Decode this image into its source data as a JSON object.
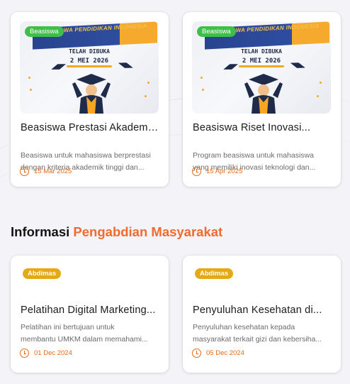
{
  "scholarship_cards": [
    {
      "badge": "Beasiswa",
      "image_banner": "BEASISWA PENDIDIKAN INDONESIA",
      "image_headline": "TELAH DIBUKA",
      "image_date": "2 MEI 2026",
      "title": "Beasiswa Prestasi Akademi...",
      "desc_line1": "Beasiswa untuk mahasiswa berprestasi",
      "desc_line2": "dengan kriteria akademik tinggi dan...",
      "date": "15 Mar 2025"
    },
    {
      "badge": "Beasiswa",
      "image_banner": "BEASISWA PENDIDIKAN INDONESIA",
      "image_headline": "TELAH DIBUKA",
      "image_date": "2 MEI 2026",
      "title": "Beasiswa Riset Inovasi...",
      "desc_line1": "Program beasiswa untuk mahasiswa",
      "desc_line2": "yang memiliki inovasi teknologi dan...",
      "date": "15 Apr 2025"
    }
  ],
  "section": {
    "heading_main": "Informasi",
    "heading_accent": "Pengabdian Masyarakat"
  },
  "abdimas_cards": [
    {
      "badge": "Abdimas",
      "title": "Pelatihan Digital Marketing...",
      "desc_line1": "Pelatihan ini bertujuan untuk",
      "desc_line2": "membantu UMKM dalam memahami...",
      "date": "01 Dec 2024"
    },
    {
      "badge": "Abdimas",
      "title": "Penyuluhan Kesehatan di...",
      "desc_line1": "Penyuluhan kesehatan kepada",
      "desc_line2": "masyarakat terkait gizi dan kebersiha...",
      "date": "05 Dec 2024"
    }
  ],
  "colors": {
    "accent_orange": "#f26a2e",
    "beasiswa_badge": "#3fbf4a",
    "abdimas_badge": "#e5a913",
    "date_text": "#e26a1b"
  },
  "icons": {
    "date": "clock-icon",
    "image": "graduate-icon"
  }
}
